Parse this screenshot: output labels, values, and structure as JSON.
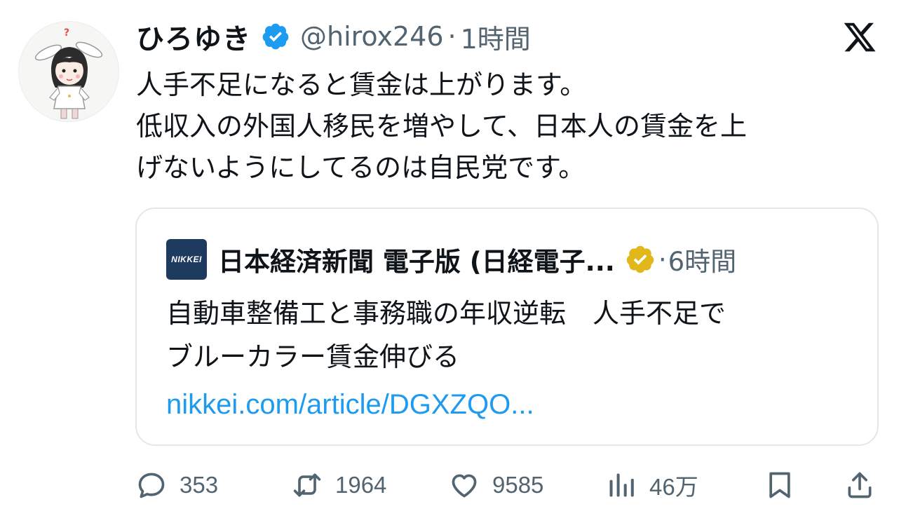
{
  "author": {
    "display_name": "ひろゆき",
    "handle": "@hirox246",
    "separator": "·",
    "time": "1時間"
  },
  "tweet": {
    "lines": [
      "人手不足になると賃金は上がります。",
      "低収入の外国人移民を増やして、日本人の賃金を上",
      "げないようにしてるのは自民党です。"
    ]
  },
  "quote": {
    "logo_text": "NIKKEI",
    "name": "日本経済新聞 電子版 (日経電子...",
    "separator": "·",
    "time": "6時間",
    "lines": [
      "自動車整備工と事務職の年収逆転　人手不足で",
      "ブルーカラー賃金伸びる"
    ],
    "link": "nikkei.com/article/DGXZQO..."
  },
  "actions": {
    "replies": "353",
    "retweets": "1964",
    "likes": "9585",
    "views": "46万"
  },
  "colors": {
    "text": "#0f1419",
    "secondary": "#536471",
    "link": "#1d9bf0",
    "verified_blue": "#1d9bf0",
    "verified_gold": "#e2b719",
    "nikkei_logo_bg": "#1f3a5f",
    "card_border": "#e1e8ed"
  },
  "icons": {
    "verified": "verified-badge-icon",
    "gold_verified": "gold-verified-badge-icon",
    "platform": "x-logo-icon",
    "reply": "reply-icon",
    "retweet": "retweet-icon",
    "like": "heart-icon",
    "views": "views-icon",
    "bookmark": "bookmark-icon",
    "share": "share-icon"
  }
}
